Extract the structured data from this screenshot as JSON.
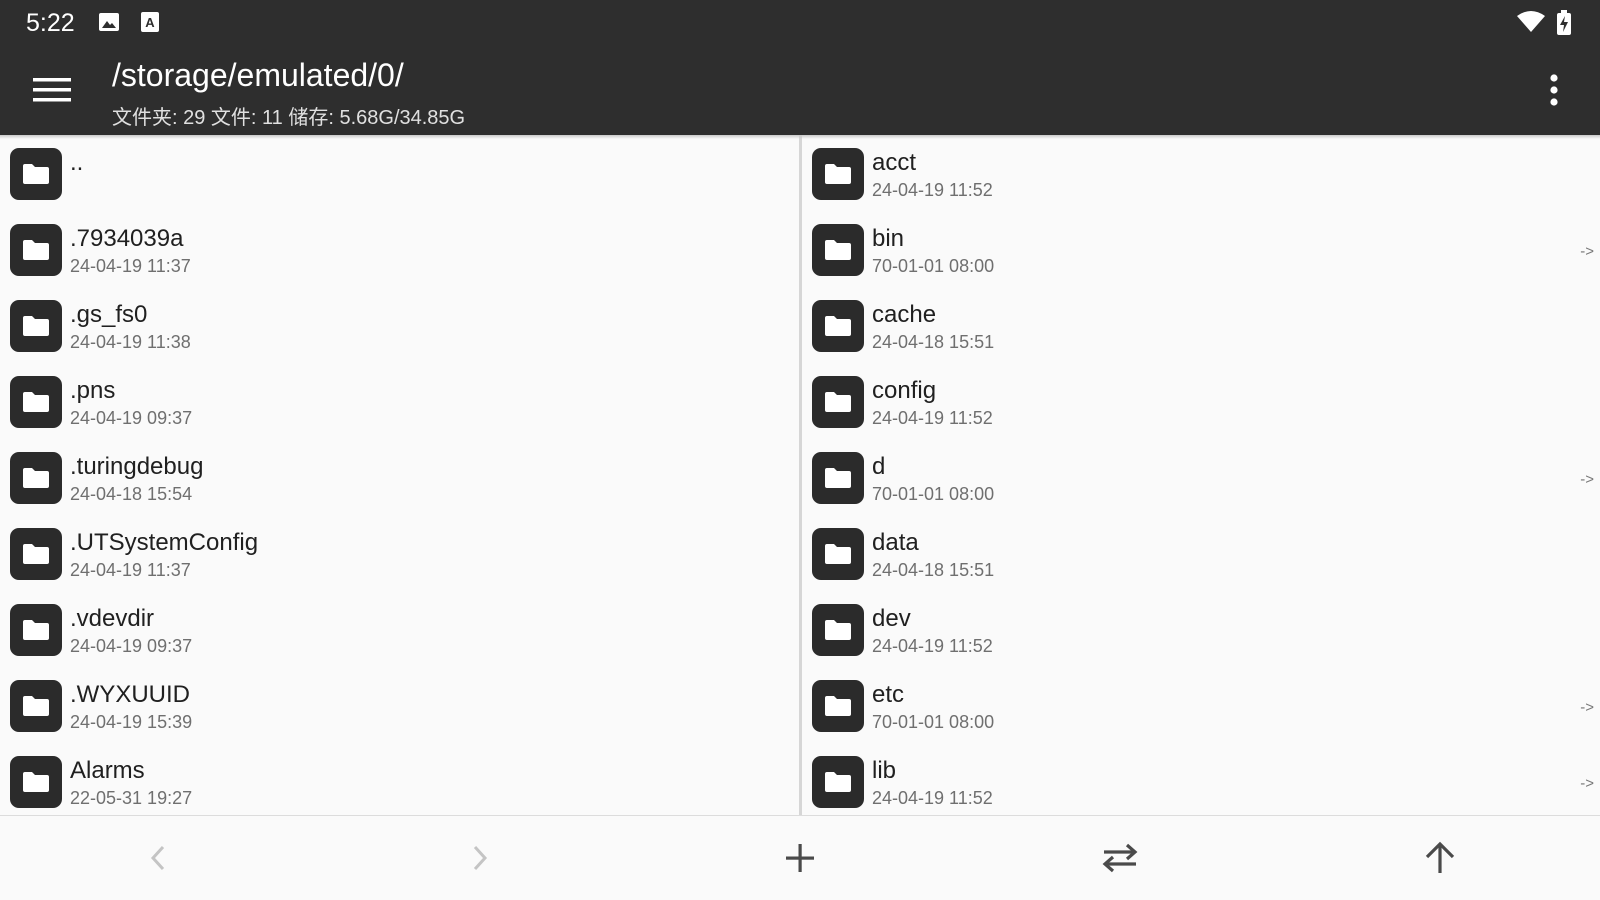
{
  "status_bar": {
    "time": "5:22",
    "icons": [
      "image-icon",
      "keyboard-a-icon",
      "wifi-icon",
      "battery-charging-icon"
    ]
  },
  "app_bar": {
    "title": "/storage/emulated/0/",
    "subtitle": "文件夹: 29  文件: 11  储存: 5.68G/34.85G",
    "menu_icon": "hamburger-menu-icon",
    "overflow_icon": "more-vert-icon"
  },
  "left_pane": {
    "items": [
      {
        "name": "..",
        "date": ""
      },
      {
        "name": ".7934039a",
        "date": "24-04-19 11:37"
      },
      {
        "name": ".gs_fs0",
        "date": "24-04-19 11:38"
      },
      {
        "name": ".pns",
        "date": "24-04-19 09:37"
      },
      {
        "name": ".turingdebug",
        "date": "24-04-18 15:54"
      },
      {
        "name": ".UTSystemConfig",
        "date": "24-04-19 11:37"
      },
      {
        "name": ".vdevdir",
        "date": "24-04-19 09:37"
      },
      {
        "name": ".WYXUUID",
        "date": "24-04-19 15:39"
      },
      {
        "name": "Alarms",
        "date": "22-05-31 19:27"
      }
    ]
  },
  "right_pane": {
    "items": [
      {
        "name": "acct",
        "date": "24-04-19 11:52",
        "link": ""
      },
      {
        "name": "bin",
        "date": "70-01-01 08:00",
        "link": "->"
      },
      {
        "name": "cache",
        "date": "24-04-18 15:51",
        "link": ""
      },
      {
        "name": "config",
        "date": "24-04-19 11:52",
        "link": ""
      },
      {
        "name": "d",
        "date": "70-01-01 08:00",
        "link": "->"
      },
      {
        "name": "data",
        "date": "24-04-18 15:51",
        "link": ""
      },
      {
        "name": "dev",
        "date": "24-04-19 11:52",
        "link": ""
      },
      {
        "name": "etc",
        "date": "70-01-01 08:00",
        "link": "->"
      },
      {
        "name": "lib",
        "date": "24-04-19 11:52",
        "link": "->"
      }
    ]
  },
  "bottom_bar": {
    "buttons": [
      "back-arrow-icon",
      "forward-arrow-icon",
      "add-icon",
      "swap-icon",
      "up-arrow-icon"
    ]
  },
  "colors": {
    "app_bar": "#2e2e2e",
    "folder_icon": "#2b2b2b",
    "background": "#fafafa"
  }
}
